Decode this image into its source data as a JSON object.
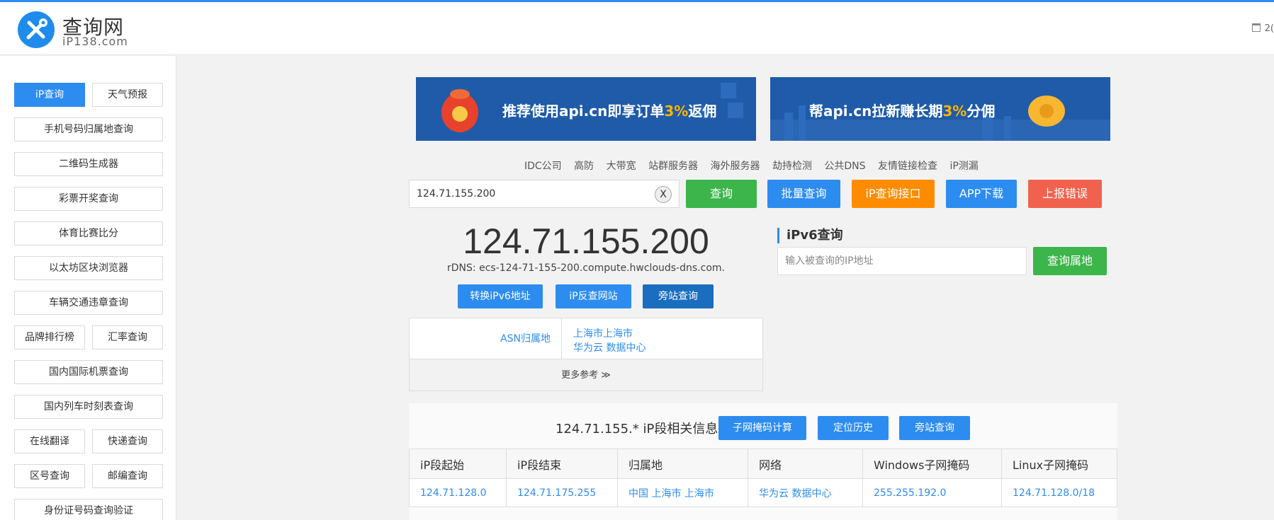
{
  "header": {
    "logo_title": "查询网",
    "logo_sub": "iP138.com",
    "right_text": "2("
  },
  "sidebar": {
    "items": [
      {
        "label": "iP查询",
        "active": true
      },
      {
        "label": "天气预报"
      },
      {
        "label": "手机号码归属地查询"
      },
      {
        "label": "二维码生成器"
      },
      {
        "label": "彩票开奖查询"
      },
      {
        "label": "体育比赛比分"
      },
      {
        "label": "以太坊区块浏览器"
      },
      {
        "label": "车辆交通违章查询"
      },
      {
        "label": "品牌排行榜"
      },
      {
        "label": "汇率查询"
      },
      {
        "label": "国内国际机票查询"
      },
      {
        "label": "国内列车时刻表查询"
      },
      {
        "label": "在线翻译"
      },
      {
        "label": "快递查询"
      },
      {
        "label": "区号查询"
      },
      {
        "label": "邮编查询"
      },
      {
        "label": "身份证号码查询验证"
      }
    ]
  },
  "banners": {
    "left": {
      "pre": "推荐使用api.cn即享订单",
      "hl": "3%",
      "post": "返佣"
    },
    "right": {
      "pre": "帮api.cn拉新赚长期",
      "hl": "3%",
      "post": "分佣"
    }
  },
  "toplinks": [
    "IDC公司",
    "高防",
    "大带宽",
    "站群服务器",
    "海外服务器",
    "劫持检测",
    "公共DNS",
    "友情链接检查",
    "iP测漏"
  ],
  "search": {
    "value": "124.71.155.200",
    "clear_label": "X"
  },
  "actions": {
    "query": "查询",
    "batch": "批量查询",
    "api": "iP查询接口",
    "app": "APP下载",
    "report": "上报错误"
  },
  "result": {
    "ip": "124.71.155.200",
    "rdns": "rDNS: ecs-124-71-155-200.compute.hwclouds-dns.com.",
    "btn_ipv6": "转换iPv6地址",
    "btn_reverse": "iP反查网站",
    "btn_side": "旁站查询",
    "asn_label": "ASN归属地",
    "asn_line1": "上海市上海市",
    "asn_line2": "华为云 数据中心",
    "more_ref": "更多参考 ≫"
  },
  "ipv6": {
    "title": "iPv6查询",
    "placeholder": "输入被查询的IP地址",
    "button": "查询属地"
  },
  "segment": {
    "title": "124.71.155.* iP段相关信息",
    "btn_subnet": "子网掩码计算",
    "btn_history": "定位历史",
    "btn_side": "旁站查询",
    "headers": [
      "iP段起始",
      "iP段结束",
      "归属地",
      "网络",
      "Windows子网掩码",
      "Linux子网掩码"
    ],
    "row": [
      "124.71.128.0",
      "124.71.175.255",
      "中国 上海市 上海市",
      "华为云 数据中心",
      "255.255.192.0",
      "124.71.128.0/18"
    ]
  },
  "colors": {
    "accent": "#2d8cf0",
    "green": "#3cb54a",
    "orange": "#ff8c00",
    "red": "#f0624d"
  }
}
